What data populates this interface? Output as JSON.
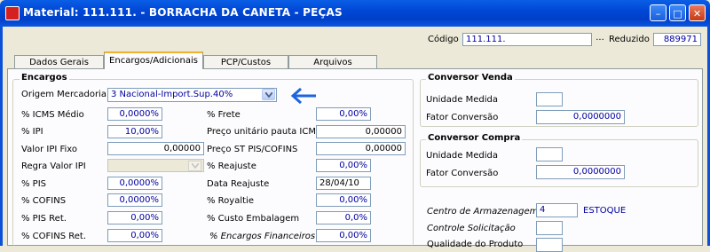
{
  "window": {
    "title": "Material: 111.111. - BORRACHA DA CANETA - PEÇAS"
  },
  "header": {
    "codigo_label": "Código",
    "codigo_value": "111.111.",
    "dots": "...",
    "reduzido_label": "Reduzido",
    "reduzido_value": "889971"
  },
  "tabs": [
    "Dados Gerais",
    "Encargos/Adicionais",
    "PCP/Custos",
    "Arquivos"
  ],
  "encargos": {
    "title": "Encargos",
    "origem_label": "Origem Mercadoria",
    "origem_value": "3 Nacional-Import.Sup.40%",
    "icms_medio_label": "% ICMS Médio",
    "icms_medio": "0,0000%",
    "ipi_label": "% IPI",
    "ipi": "10,00%",
    "valor_ipi_fixo_label": "Valor IPI Fixo",
    "valor_ipi_fixo": "0,00000",
    "regra_ipi_label": "Regra Valor IPI",
    "regra_ipi": "",
    "pis_label": "% PIS",
    "pis": "0,0000%",
    "cofins_label": "% COFINS",
    "cofins": "0,0000%",
    "pis_ret_label": "% PIS Ret.",
    "pis_ret": "0,00%",
    "cofins_ret_label": "% COFINS Ret.",
    "cofins_ret": "0,00%",
    "frete_label": "% Frete",
    "frete": "0,00%",
    "preco_pauta_label": "Preço unitário pauta ICMS",
    "preco_pauta": "0,00000",
    "preco_st_label": "Preço ST PIS/COFINS",
    "preco_st": "0,00000",
    "reajuste_label": "% Reajuste",
    "reajuste": "0,00%",
    "data_reajuste_label": "Data Reajuste",
    "data_reajuste": "28/04/10",
    "royaltie_label": "% Royaltie",
    "royaltie": "0,00%",
    "custo_emb_label": "% Custo Embalagem",
    "custo_emb": "0,0%",
    "enc_fin_label": "% Encargos Financeiros",
    "enc_fin": "0,00%"
  },
  "conversor_venda": {
    "title": "Conversor Venda",
    "unidade_label": "Unidade Medida",
    "unidade": "",
    "fator_label": "Fator Conversão",
    "fator": "0,0000000"
  },
  "conversor_compra": {
    "title": "Conversor Compra",
    "unidade_label": "Unidade Medida",
    "unidade": "",
    "fator_label": "Fator Conversão",
    "fator": "0,0000000"
  },
  "estoque": {
    "centro_label": "Centro de Armazenagem",
    "centro_value": "4",
    "centro_name": "ESTOQUE",
    "controle_label": "Controle Solicitação",
    "controle_value": "",
    "qualidade_label": "Qualidade do Produto",
    "qualidade_value": ""
  },
  "colors": {
    "title_bar": "#0047d6",
    "arrow": "#1c64e0",
    "field_text": "#0000a0",
    "window_bg": "#ece9d8"
  },
  "icons": [
    "app-icon",
    "minimize-icon",
    "maximize-icon",
    "close-icon",
    "dropdown-arrow-icon",
    "pointer-arrow-icon"
  ]
}
